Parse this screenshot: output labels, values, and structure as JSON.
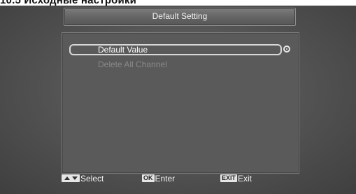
{
  "document": {
    "heading": "10.5 Исходные настройки"
  },
  "screen": {
    "title": "Default Setting",
    "menu": [
      {
        "label": "Default Value",
        "state": "selected",
        "icon": "radio-icon"
      },
      {
        "label": "Delete All Channel",
        "state": "disabled"
      }
    ],
    "footer": {
      "select_icon": "up-down-arrows-icon",
      "select_label": "Select",
      "enter_key": "OK",
      "enter_label": "Enter",
      "exit_key": "EXIT",
      "exit_label": "Exit"
    }
  }
}
